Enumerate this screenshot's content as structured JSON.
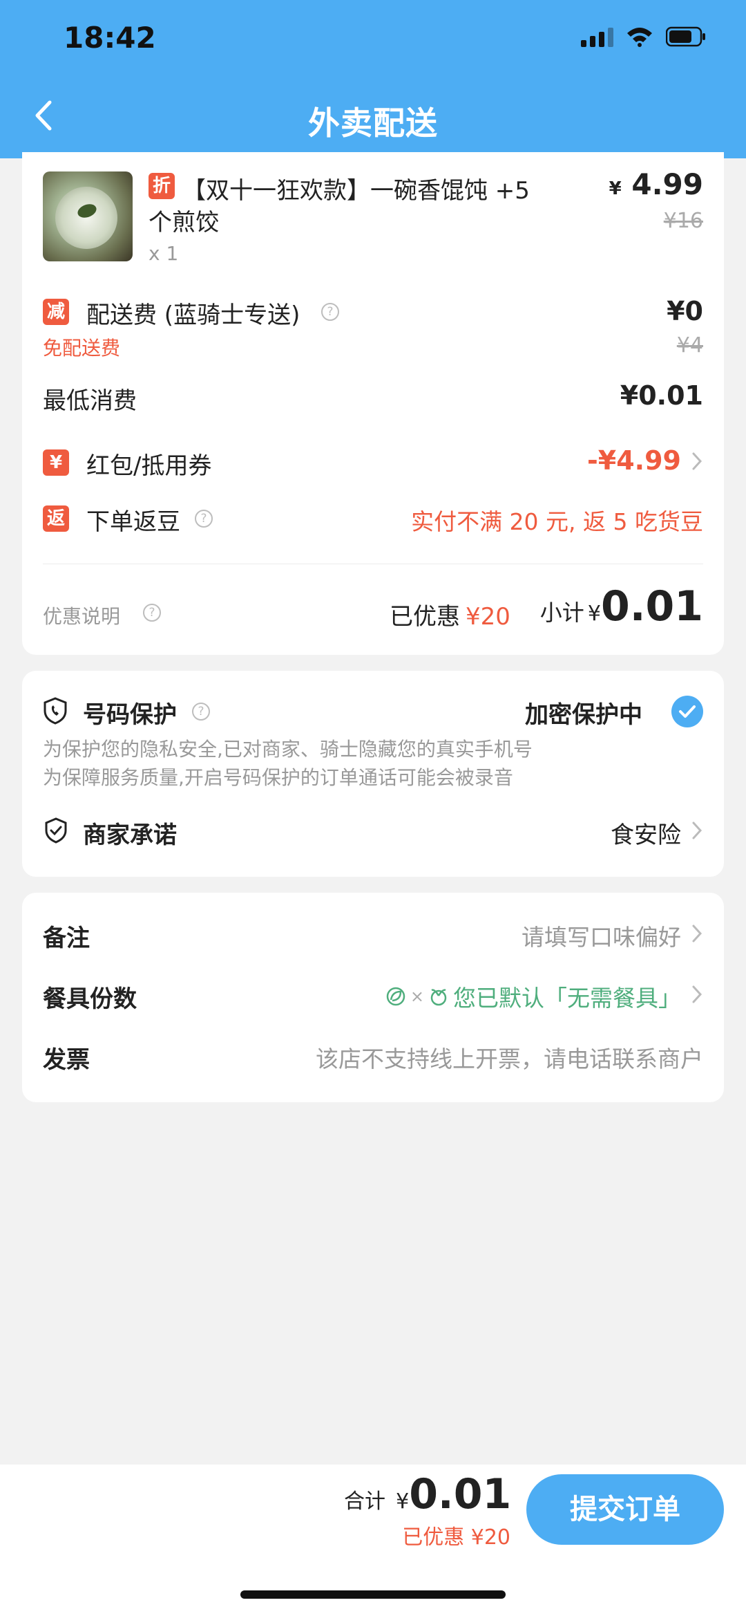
{
  "status_bar": {
    "time": "18:42"
  },
  "header": {
    "title": "外卖配送"
  },
  "order": {
    "item": {
      "discount_tag": "折",
      "name_line1": "【双十一狂欢款】一碗香馄饨 +5",
      "name_line2": "个煎饺",
      "qty": "x 1",
      "price_symbol": "¥",
      "price": "4.99",
      "original_price": "¥16"
    },
    "delivery": {
      "tag": "减",
      "label": "配送费 (蓝骑士专送)",
      "note": "免配送费",
      "price": "¥0",
      "original_price": "¥4"
    },
    "min_spend": {
      "label": "最低消费",
      "value": "¥0.01"
    },
    "coupon": {
      "tag": "¥",
      "label": "红包/抵用券",
      "value": "-¥4.99"
    },
    "beans": {
      "tag": "返",
      "label": "下单返豆",
      "value": "实付不满 20 元, 返 5 吃货豆"
    },
    "summary": {
      "explain_label": "优惠说明",
      "saved_label": "已优惠",
      "saved_value": "¥20",
      "subtotal_label": "小计",
      "subtotal_symbol": "¥",
      "subtotal_value": "0.01"
    }
  },
  "protection": {
    "label": "号码保护",
    "status": "加密保护中",
    "desc1": "为保护您的隐私安全,已对商家、骑士隐藏您的真实手机号",
    "desc2": "为保障服务质量,开启号码保护的订单通话可能会被录音",
    "promise_label": "商家承诺",
    "promise_value": "食安险"
  },
  "notes": {
    "remark_label": "备注",
    "remark_placeholder": "请填写口味偏好",
    "tableware_label": "餐具份数",
    "tableware_value": "您已默认「无需餐具」",
    "tableware_x": "×",
    "invoice_label": "发票",
    "invoice_value": "该店不支持线上开票，请电话联系商户"
  },
  "footer": {
    "total_label": "合计",
    "total_symbol": "¥",
    "total_value": "0.01",
    "saved": "已优惠 ¥20",
    "submit_label": "提交订单"
  },
  "colors": {
    "accent": "#4dadf3",
    "discount_red": "#ef5b3f",
    "eco_green": "#4fae7d"
  }
}
